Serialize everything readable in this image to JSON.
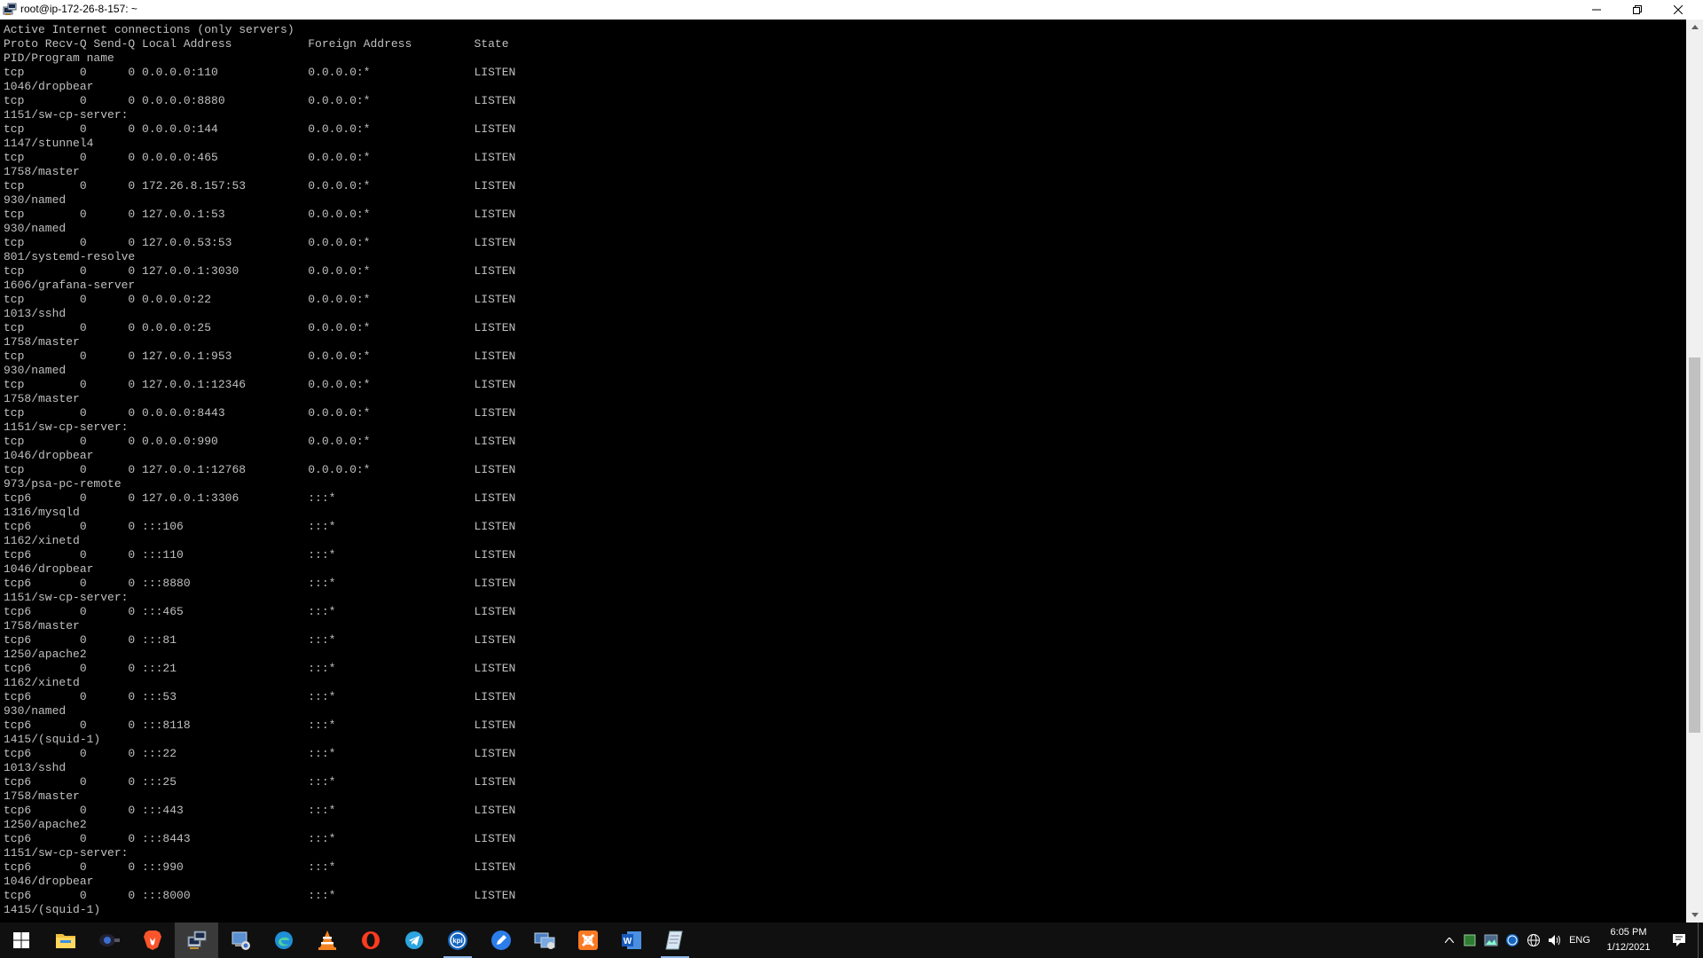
{
  "window": {
    "title": "root@ip-172-26-8-157: ~",
    "icon": "putty-icon"
  },
  "terminal": {
    "lines": [
      "Active Internet connections (only servers)",
      "Proto Recv-Q Send-Q Local Address           Foreign Address         State",
      "PID/Program name",
      "tcp        0      0 0.0.0.0:110             0.0.0.0:*               LISTEN",
      "1046/dropbear",
      "tcp        0      0 0.0.0.0:8880            0.0.0.0:*               LISTEN",
      "1151/sw-cp-server:",
      "tcp        0      0 0.0.0.0:144             0.0.0.0:*               LISTEN",
      "1147/stunnel4",
      "tcp        0      0 0.0.0.0:465             0.0.0.0:*               LISTEN",
      "1758/master",
      "tcp        0      0 172.26.8.157:53         0.0.0.0:*               LISTEN",
      "930/named",
      "tcp        0      0 127.0.0.1:53            0.0.0.0:*               LISTEN",
      "930/named",
      "tcp        0      0 127.0.0.53:53           0.0.0.0:*               LISTEN",
      "801/systemd-resolve",
      "tcp        0      0 127.0.0.1:3030          0.0.0.0:*               LISTEN",
      "1606/grafana-server",
      "tcp        0      0 0.0.0.0:22              0.0.0.0:*               LISTEN",
      "1013/sshd",
      "tcp        0      0 0.0.0.0:25              0.0.0.0:*               LISTEN",
      "1758/master",
      "tcp        0      0 127.0.0.1:953           0.0.0.0:*               LISTEN",
      "930/named",
      "tcp        0      0 127.0.0.1:12346         0.0.0.0:*               LISTEN",
      "1758/master",
      "tcp        0      0 0.0.0.0:8443            0.0.0.0:*               LISTEN",
      "1151/sw-cp-server:",
      "tcp        0      0 0.0.0.0:990             0.0.0.0:*               LISTEN",
      "1046/dropbear",
      "tcp        0      0 127.0.0.1:12768         0.0.0.0:*               LISTEN",
      "973/psa-pc-remote",
      "tcp6       0      0 127.0.0.1:3306          :::*                    LISTEN",
      "1316/mysqld",
      "tcp6       0      0 :::106                  :::*                    LISTEN",
      "1162/xinetd",
      "tcp6       0      0 :::110                  :::*                    LISTEN",
      "1046/dropbear",
      "tcp6       0      0 :::8880                 :::*                    LISTEN",
      "1151/sw-cp-server:",
      "tcp6       0      0 :::465                  :::*                    LISTEN",
      "1758/master",
      "tcp6       0      0 :::81                   :::*                    LISTEN",
      "1250/apache2",
      "tcp6       0      0 :::21                   :::*                    LISTEN",
      "1162/xinetd",
      "tcp6       0      0 :::53                   :::*                    LISTEN",
      "930/named",
      "tcp6       0      0 :::8118                 :::*                    LISTEN",
      "1415/(squid-1)",
      "tcp6       0      0 :::22                   :::*                    LISTEN",
      "1013/sshd",
      "tcp6       0      0 :::25                   :::*                    LISTEN",
      "1758/master",
      "tcp6       0      0 :::443                  :::*                    LISTEN",
      "1250/apache2",
      "tcp6       0      0 :::8443                 :::*                    LISTEN",
      "1151/sw-cp-server:",
      "tcp6       0      0 :::990                  :::*                    LISTEN",
      "1046/dropbear",
      "tcp6       0      0 :::8000                 :::*                    LISTEN",
      "1415/(squid-1)"
    ]
  },
  "scrollbar": {
    "thumb_start_fraction": 0.37,
    "thumb_length_fraction": 0.43
  },
  "taskbar": {
    "pinned": [
      {
        "name": "start-icon",
        "state": ""
      },
      {
        "name": "file-explorer-icon",
        "state": ""
      },
      {
        "name": "camera-app-icon",
        "state": ""
      },
      {
        "name": "brave-browser-icon",
        "state": ""
      },
      {
        "name": "putty-icon",
        "state": "active"
      },
      {
        "name": "network-tool-icon",
        "state": ""
      },
      {
        "name": "edge-browser-icon",
        "state": ""
      },
      {
        "name": "vlc-icon",
        "state": ""
      },
      {
        "name": "opera-browser-icon",
        "state": ""
      },
      {
        "name": "telegram-icon",
        "state": ""
      },
      {
        "name": "kpi-app-icon",
        "state": "running"
      },
      {
        "name": "pen-app-icon",
        "state": ""
      },
      {
        "name": "remote-access-icon",
        "state": ""
      },
      {
        "name": "xampp-icon",
        "state": ""
      },
      {
        "name": "word-icon",
        "state": ""
      },
      {
        "name": "notepad-icon",
        "state": ""
      }
    ],
    "tray": {
      "language": "ENG",
      "time": "6:05 PM",
      "date": "1/12/2021"
    }
  }
}
